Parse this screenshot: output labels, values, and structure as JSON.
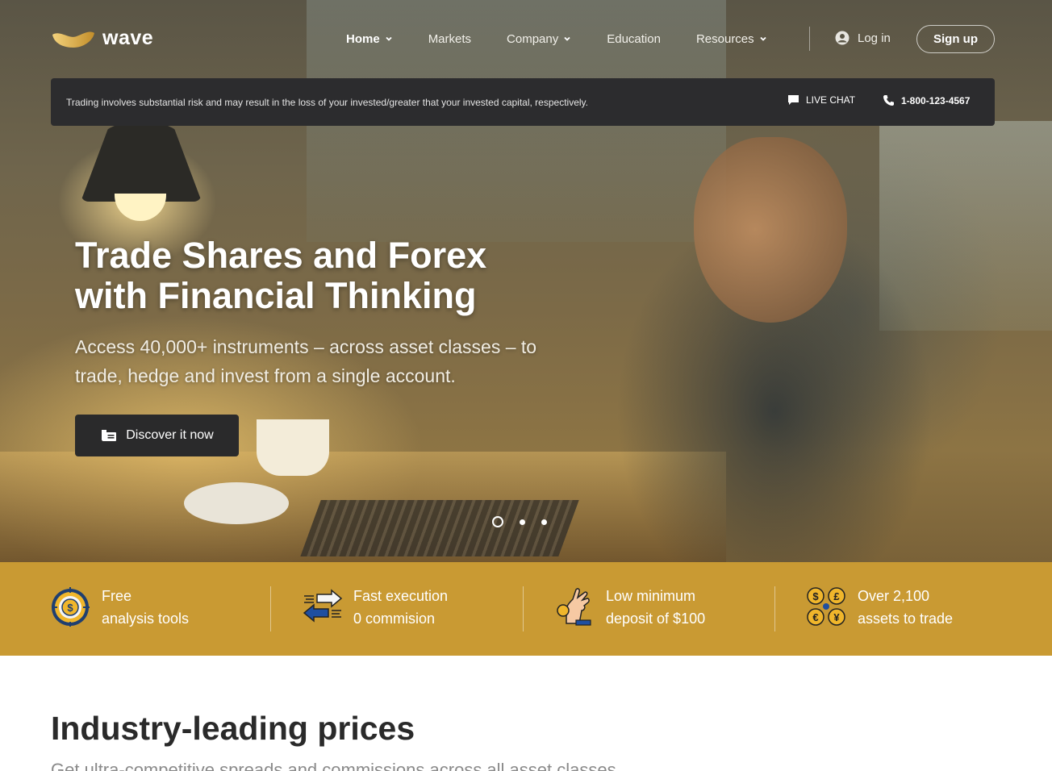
{
  "brand": {
    "name": "wave",
    "accent": "#c99a33",
    "dark": "#2c2c2e"
  },
  "nav": {
    "items": [
      {
        "label": "Home",
        "has_dropdown": true,
        "active": true
      },
      {
        "label": "Markets",
        "has_dropdown": false
      },
      {
        "label": "Company",
        "has_dropdown": true
      },
      {
        "label": "Education",
        "has_dropdown": false
      },
      {
        "label": "Resources",
        "has_dropdown": true
      }
    ],
    "login_label": "Log in",
    "signup_label": "Sign up"
  },
  "riskbar": {
    "text": "Trading involves substantial risk and may result in the loss of your invested/greater that your invested capital, respectively.",
    "livechat_label": "LIVE CHAT",
    "phone": "1-800-123-4567"
  },
  "hero": {
    "headline_line1": "Trade Shares and Forex",
    "headline_line2": "with Financial Thinking",
    "subline_line1": "Access 40,000+ instruments – across asset classes – to",
    "subline_line2": "trade, hedge and invest from a single account.",
    "cta_label": "Discover it now",
    "slides": 3,
    "active_slide": 1
  },
  "features": [
    {
      "icon": "target-dollar-icon",
      "line1": "Free",
      "line2": "analysis tools"
    },
    {
      "icon": "arrows-exchange-icon",
      "line1": "Fast execution",
      "line2": "0 commision"
    },
    {
      "icon": "hand-coin-icon",
      "line1": "Low minimum",
      "line2": "deposit of $100"
    },
    {
      "icon": "currency-coins-icon",
      "line1": "Over 2,100",
      "line2": "assets to trade"
    }
  ],
  "section": {
    "title_pre": "Industry-",
    "title_hl": "leading",
    "title_post": " prices",
    "subtitle": "Get ultra-competitive spreads and commissions across all asset classes"
  }
}
